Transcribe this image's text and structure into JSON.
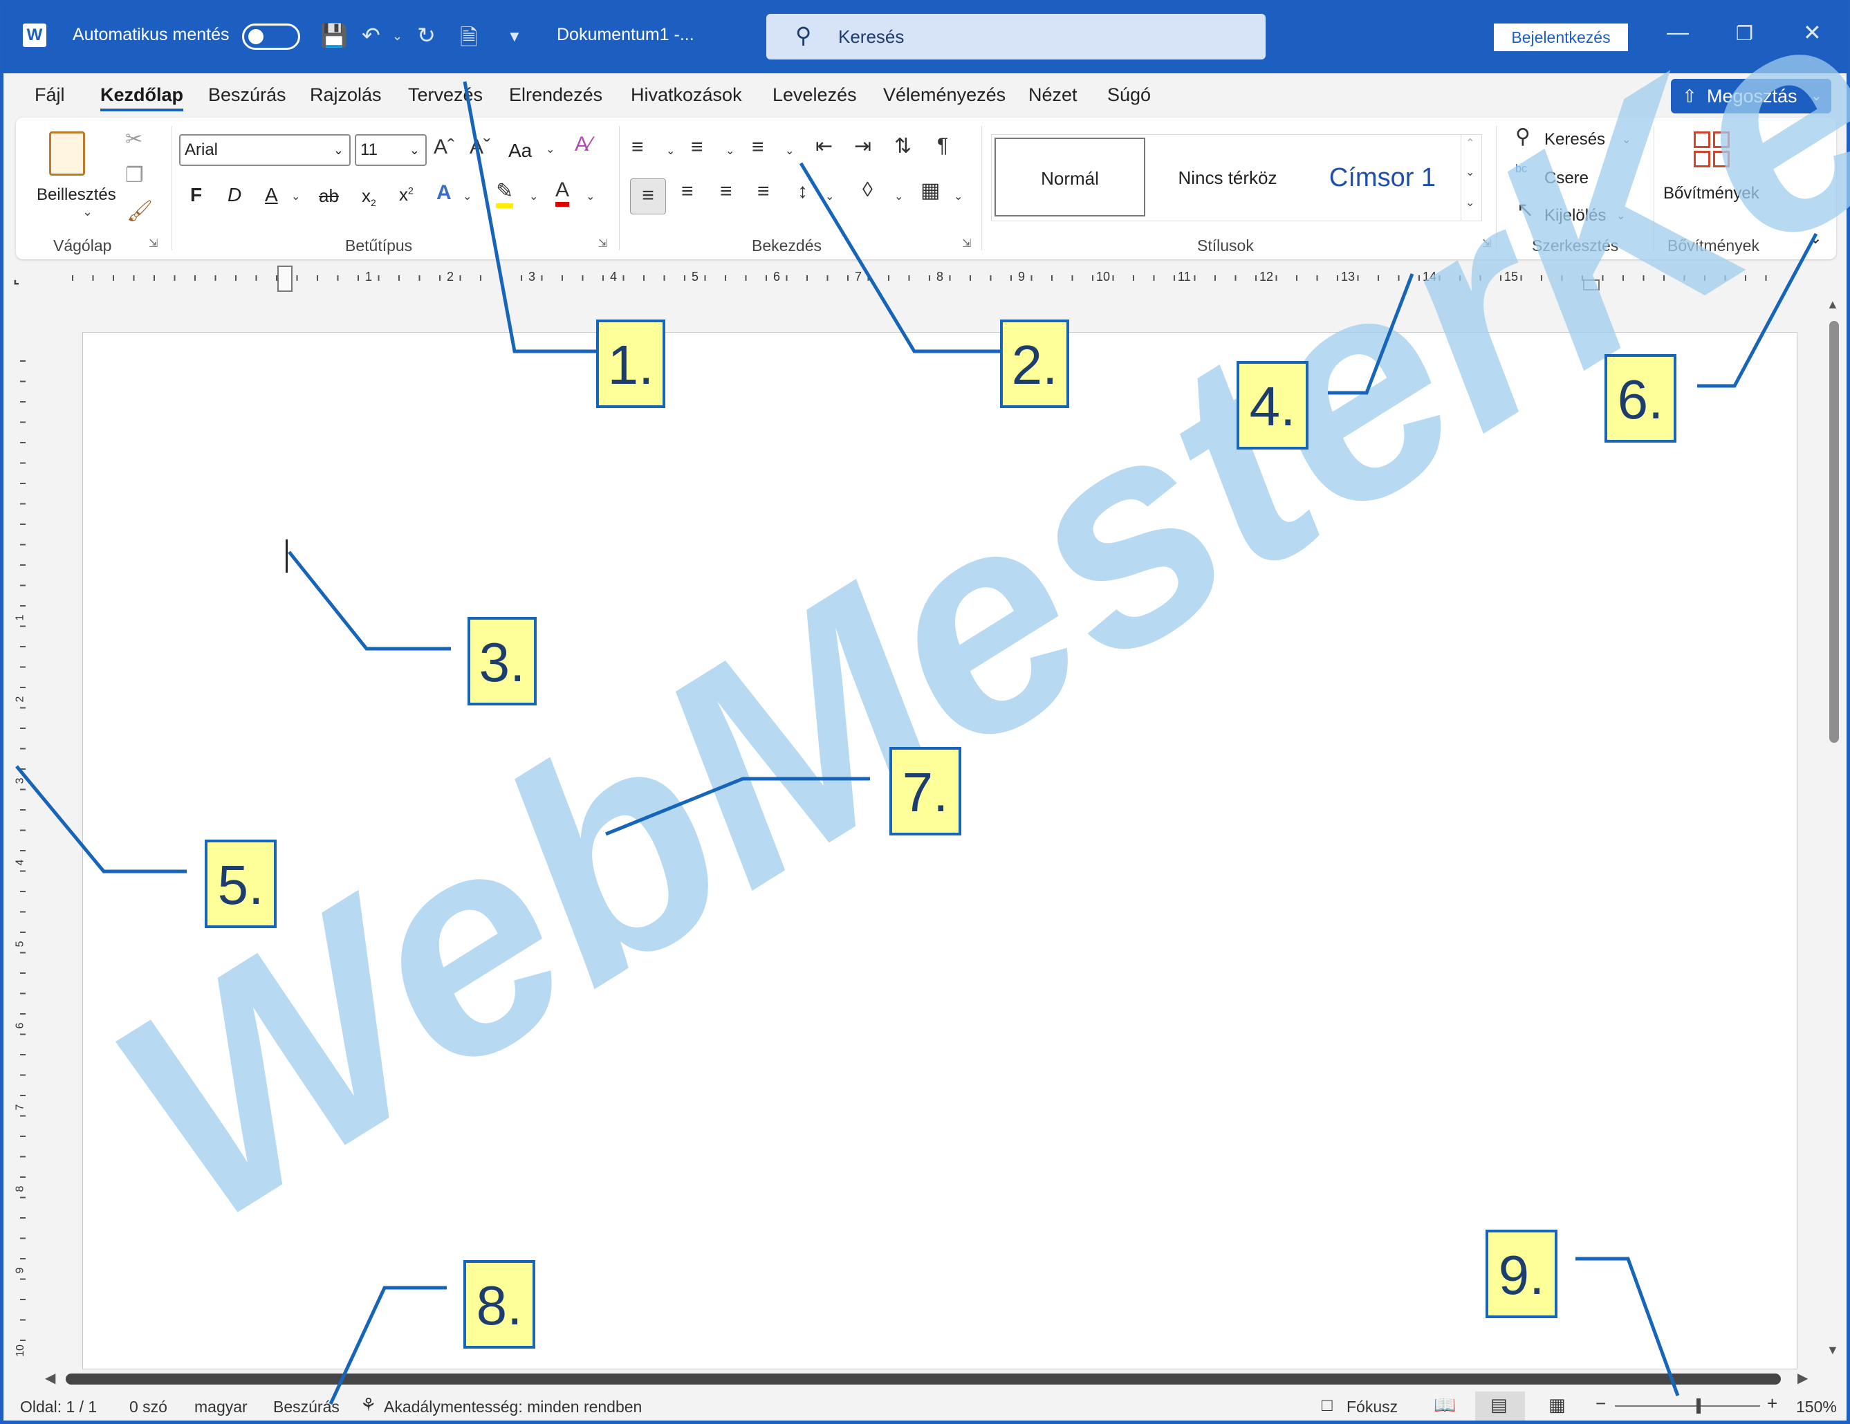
{
  "titlebar": {
    "autosave_label": "Automatikus mentés",
    "doc_title": "Dokumentum1  -...",
    "search_placeholder": "Keresés",
    "signin_label": "Bejelentkezés"
  },
  "menu": {
    "items": [
      "Fájl",
      "Kezdőlap",
      "Beszúrás",
      "Rajzolás",
      "Tervezés",
      "Elrendezés",
      "Hivatkozások",
      "Levelezés",
      "Véleményezés",
      "Nézet",
      "Súgó"
    ],
    "share_label": "Megosztás"
  },
  "ribbon": {
    "clipboard": {
      "paste_label": "Beillesztés",
      "group_label": "Vágólap"
    },
    "font": {
      "font_name": "Arial",
      "font_size": "11",
      "case_label": "Aa",
      "bold": "F",
      "italic": "D",
      "underline": "A",
      "strike": "ab",
      "sub": "x",
      "sup": "x",
      "group_label": "Betűtípus"
    },
    "paragraph": {
      "group_label": "Bekezdés"
    },
    "styles": {
      "items": [
        "Normál",
        "Nincs térköz",
        "Címsor 1"
      ],
      "group_label": "Stílusok"
    },
    "editing": {
      "find_label": "Keresés",
      "replace_label": "Csere",
      "select_label": "Kijelölés",
      "group_label": "Szerkesztés"
    },
    "addins": {
      "label": "Bővítmények",
      "group_label": "Bővítmények"
    }
  },
  "ruler": {
    "h_numbers": [
      "1",
      "2",
      "3",
      "4",
      "5",
      "6",
      "7",
      "8",
      "9",
      "10",
      "11",
      "12",
      "13",
      "14",
      "15"
    ],
    "v_numbers": [
      "1",
      "2",
      "3",
      "4",
      "5",
      "6",
      "7",
      "8",
      "9",
      "10"
    ]
  },
  "statusbar": {
    "page": "Oldal: 1 / 1",
    "words": "0 szó",
    "language": "magyar",
    "mode": "Beszúrás",
    "accessibility": "Akadálymentesség: minden rendben",
    "focus": "Fókusz",
    "zoom": "150%"
  },
  "callouts": [
    "1.",
    "2.",
    "3.",
    "4.",
    "5.",
    "6.",
    "7.",
    "8.",
    "9."
  ],
  "watermark": "WebMesterKe",
  "colors": {
    "accent": "#1d5ec1",
    "callout_fill": "#ffff99",
    "callout_border": "#1765b9",
    "watermark": "#9fcdee"
  }
}
